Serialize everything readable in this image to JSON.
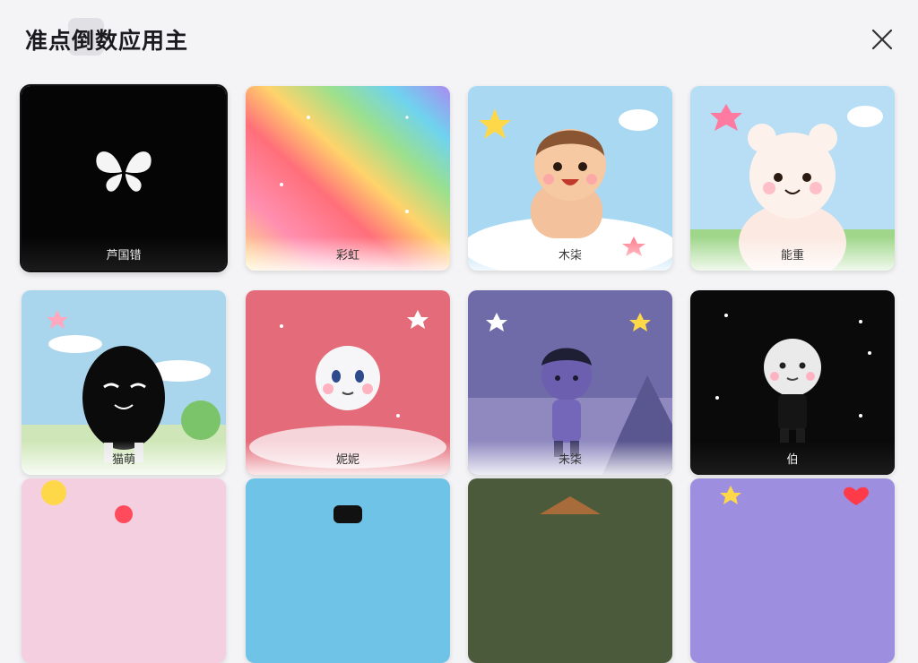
{
  "header": {
    "title": "准点倒数应用主",
    "close_icon": "close-icon"
  },
  "cards": [
    {
      "label": "芦国错",
      "theme": "black-butterfly"
    },
    {
      "label": "彩虹",
      "theme": "rainbow-gradient"
    },
    {
      "label": "木柒",
      "theme": "cartoon-boy"
    },
    {
      "label": "能重",
      "theme": "alpaca"
    },
    {
      "label": "猫萌",
      "theme": "black-ball-character"
    },
    {
      "label": "妮妮",
      "theme": "white-face-on-pink"
    },
    {
      "label": "未柒",
      "theme": "purple-boy-night"
    },
    {
      "label": "伯",
      "theme": "white-face-on-black"
    }
  ],
  "colors": {
    "background": "#f4f4f6",
    "title_text": "#1b1b1f",
    "selected_outline": "#111111"
  }
}
